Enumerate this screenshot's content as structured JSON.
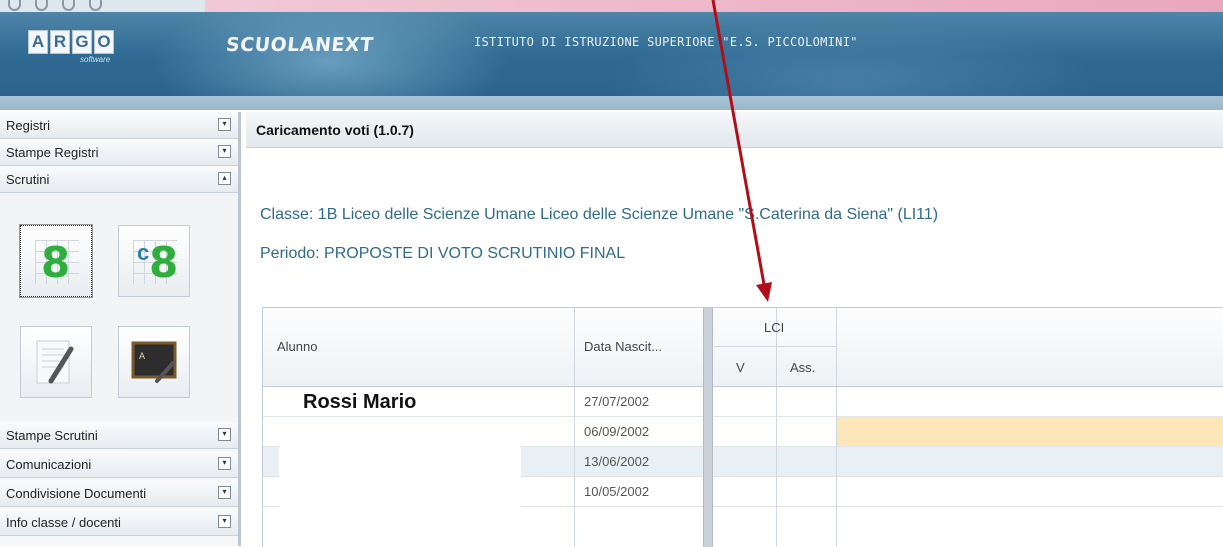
{
  "header": {
    "logo_letters": [
      "A",
      "R",
      "G",
      "O"
    ],
    "logo_sub": "software",
    "brand": "SCUOLANEXT",
    "school": "ISTITUTO DI ISTRUZIONE SUPERIORE \"E.S. PICCOLOMINI\""
  },
  "sidebar": {
    "items_top": [
      {
        "label": "Registri",
        "toggle": "▾"
      },
      {
        "label": "Stampe Registri",
        "toggle": "▾"
      },
      {
        "label": "Scrutini",
        "toggle": "▴"
      }
    ],
    "items_bottom": [
      {
        "label": "Stampe Scrutini",
        "toggle": "▾"
      },
      {
        "label": "Comunicazioni",
        "toggle": "▾"
      },
      {
        "label": "Condivisione Documenti",
        "toggle": "▾"
      },
      {
        "label": "Info classe / docenti",
        "toggle": "▾"
      }
    ],
    "icon_eight": "8",
    "icon_refresh": "c"
  },
  "main": {
    "title": "Caricamento voti (1.0.7)",
    "classe": "Classe: 1B Liceo delle Scienze Umane Liceo delle Scienze Umane \"S.Caterina da Siena\" (LI11)",
    "periodo": "Periodo: PROPOSTE DI VOTO SCRUTINIO FINAL"
  },
  "table": {
    "col_alunno": "Alunno",
    "col_data": "Data Nascit...",
    "group_lci": "LCI",
    "col_v": "V",
    "col_ass": "Ass.",
    "rows": [
      {
        "name": "Rossi Mario",
        "date": "27/07/2002"
      },
      {
        "name": "",
        "date": "06/09/2002"
      },
      {
        "name": "",
        "date": "13/06/2002"
      },
      {
        "name": "",
        "date": "10/05/2002"
      }
    ]
  },
  "colors": {
    "header_bg": "#2f6a93",
    "info_text": "#2f6b8b",
    "highlight_row": "#fbe7b8",
    "alt_row": "#e8eff5",
    "arrow": "#b00f1a"
  }
}
